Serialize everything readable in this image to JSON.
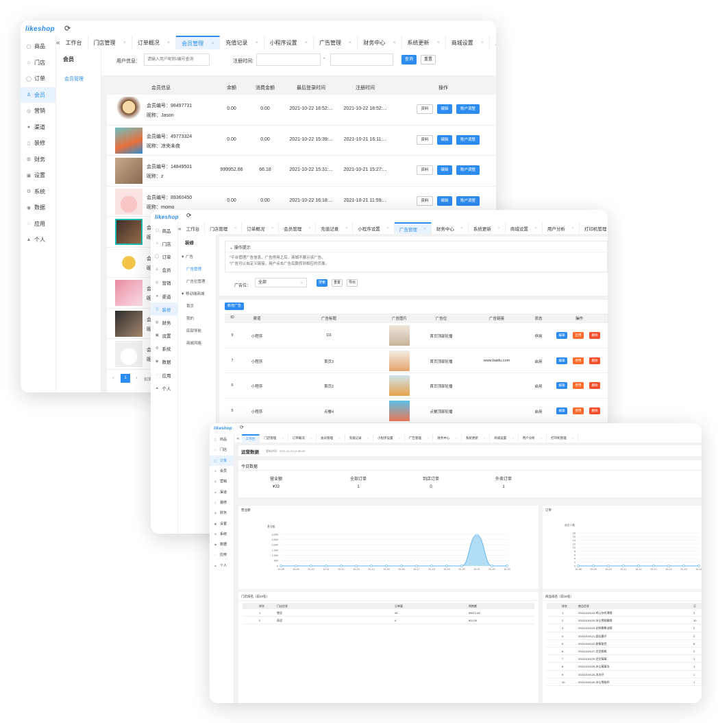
{
  "sidebar": {
    "logo": "likeshop",
    "items": [
      {
        "label": "商品",
        "icon": "goods-icon"
      },
      {
        "label": "门店",
        "icon": "store-icon"
      },
      {
        "label": "订单",
        "icon": "order-icon"
      },
      {
        "label": "会员",
        "icon": "user-icon"
      },
      {
        "label": "营销",
        "icon": "marketing-icon"
      },
      {
        "label": "渠道",
        "icon": "channel-icon"
      },
      {
        "label": "装修",
        "icon": "decorate-icon"
      },
      {
        "label": "财务",
        "icon": "finance-icon"
      },
      {
        "label": "设置",
        "icon": "settings-icon"
      },
      {
        "label": "系统",
        "icon": "system-icon"
      },
      {
        "label": "数据",
        "icon": "data-icon"
      },
      {
        "label": "应用",
        "icon": "app-icon"
      },
      {
        "label": "个人",
        "icon": "person-icon"
      }
    ]
  },
  "tabs": [
    "工作台",
    "门店管理",
    "订单概况",
    "会员管理",
    "充值记录",
    "小程序设置",
    "广告管理",
    "财务中心",
    "系统更新",
    "商城设置",
    "用户分析",
    "打印机管理"
  ],
  "win1": {
    "sub_title": "会员",
    "sub_item": "会员管理",
    "filter": {
      "user_label": "用户信息：",
      "user_placeholder": "请输入用户昵称/编号查询",
      "reg_label": "注册时间:",
      "dash": "-",
      "query": "查询",
      "reset": "重置"
    },
    "columns": [
      "会员信息",
      "余额",
      "消费金额",
      "最后登录时间",
      "注册时间",
      "操作"
    ],
    "rows": [
      {
        "id": "会员编号：98497731",
        "nick": "昵称：Jason",
        "balance": "0.00",
        "spent": "0.00",
        "last": "2021-10-22 18:52:...",
        "reg": "2021-10-22 18:52:..."
      },
      {
        "id": "会员编号：49773324",
        "nick": "昵称：凉夹未夜",
        "balance": "0.00",
        "spent": "0.00",
        "last": "2021-10-22 15:39:...",
        "reg": "2021-10-21 16:11:..."
      },
      {
        "id": "会员编号：14849501",
        "nick": "昵称：z",
        "balance": "999952.86",
        "spent": "66.18",
        "last": "2021-10-22 15:31:...",
        "reg": "2021-10-21 15:27:..."
      },
      {
        "id": "会员编号：89360450",
        "nick": "昵称：momo",
        "balance": "0.00",
        "spent": "0.00",
        "last": "2021-10-22 16:18:...",
        "reg": "2021-10-21 11:59:..."
      }
    ],
    "partial": [
      "会",
      "昵",
      "会",
      "昵",
      "会",
      "昵",
      "会",
      "昵",
      "会",
      "昵"
    ],
    "actions": {
      "info": "资料",
      "edit": "编辑",
      "adjust": "账户调整"
    },
    "page": "1",
    "page_tail": "如第"
  },
  "win2": {
    "sub_title": "装修",
    "tree": [
      {
        "label": "▼ 广告",
        "level": 0
      },
      {
        "label": "广告管理",
        "level": 1,
        "active": true
      },
      {
        "label": "广告位管理",
        "level": 1
      },
      {
        "label": "▼ 移动端商城",
        "level": 0
      },
      {
        "label": "首页",
        "level": 1
      },
      {
        "label": "我的",
        "level": 1
      },
      {
        "label": "底部导航",
        "level": 1
      },
      {
        "label": "商城风格",
        "level": 1
      }
    ],
    "tip_title": "操作提示",
    "tips": [
      "*平台管理广告信息，广告停用之后，商城不展示该广告。",
      "*广告可以自定义链接，用户点击广告后跳转到相应的页面。"
    ],
    "filter": {
      "label": "广告位：",
      "value": "全部",
      "query": "搜索",
      "reset": "重置",
      "export": "导出"
    },
    "add": "新增广告",
    "columns": [
      "ID",
      "渠道",
      "广告标题",
      "广告图片",
      "广告位",
      "广告链接",
      "状态",
      "操作"
    ],
    "rows": [
      {
        "id": "9",
        "ch": "小程序",
        "title": "111",
        "pos": "首页顶部轮播",
        "link": "",
        "status": "停用",
        "toggle": "启用"
      },
      {
        "id": "7",
        "ch": "小程序",
        "title": "首页3",
        "pos": "首页顶部轮播",
        "link": "www.baidu.com",
        "status": "启用",
        "toggle": "停用"
      },
      {
        "id": "6",
        "ch": "小程序",
        "title": "首页2",
        "pos": "首页顶部轮播",
        "link": "",
        "status": "启用",
        "toggle": "停用"
      },
      {
        "id": "5",
        "ch": "小程序",
        "title": "点餐4",
        "pos": "点餐顶部轮播",
        "link": "",
        "status": "启用",
        "toggle": "停用"
      }
    ],
    "actions": {
      "edit": "编辑",
      "delete": "删除"
    }
  },
  "win3": {
    "title": "运营数据",
    "updated": "更新时间：2021-10-23 11:36:48",
    "today": "今日数据",
    "stats": [
      {
        "label": "营业额",
        "value": "¥33"
      },
      {
        "label": "全部订单",
        "value": "1"
      },
      {
        "label": "到店订单",
        "value": "0"
      },
      {
        "label": "外卖订单",
        "value": "1"
      }
    ],
    "chart1_title": "营业额",
    "chart2_title": "订单",
    "store_title": "门店排名（前10名）",
    "store_cols": [
      "排名",
      "门店信息",
      "订单量",
      "销售额"
    ],
    "store_rows": [
      [
        "1",
        "雪泥",
        "26",
        "¥3071.48"
      ],
      [
        "2",
        "雨泥",
        "4",
        "¥11.00"
      ]
    ],
    "goods_title": "商品排名（前10名）",
    "goods_cols": [
      "排名",
      "商品信息",
      "订"
    ],
    "goods_rows": [
      [
        "1",
        "20211019123-鸡公杂的渴哦",
        "3"
      ],
      [
        "2",
        "20211019120-冰山雪糕霸哦",
        "10"
      ],
      [
        "3",
        "20211019123-花样椰椰油哦",
        "2"
      ],
      [
        "4",
        "20211019121-面佳番仔",
        "2"
      ],
      [
        "5",
        "20211019122-甜蜜甜芭",
        "6"
      ],
      [
        "6",
        "20211019127-芝芝桃桃",
        "2"
      ],
      [
        "7",
        "20211019129-芝芝莓莓",
        "1"
      ],
      [
        "8",
        "20211019128-冰山莓莓冻",
        "1"
      ],
      [
        "9",
        "20211019124-冻冻仔",
        "1"
      ],
      [
        "10",
        "20211019120-冰山雪糕杯",
        "1"
      ]
    ]
  },
  "chart_data": [
    {
      "type": "area",
      "title": "营业额",
      "ylabel": "营业额",
      "categories": [
        "10-08",
        "10-09",
        "10-10",
        "10-11",
        "10-12",
        "10-13",
        "10-14",
        "10-15",
        "10-16",
        "10-17",
        "10-18",
        "10-19",
        "10-20",
        "10-21",
        "10-22",
        "10-23"
      ],
      "values": [
        0,
        0,
        0,
        0,
        0,
        0,
        0,
        0,
        0,
        0,
        0,
        0,
        0,
        2950,
        0,
        0
      ],
      "yticks": [
        "3,000",
        "2,500",
        "2,000",
        "1,500",
        "1,000",
        "500",
        "0"
      ],
      "ylim": [
        0,
        3000
      ]
    },
    {
      "type": "line",
      "title": "订单",
      "ylabel": "成交人数",
      "categories": [
        "10-08",
        "10-09",
        "10-10",
        "10-11",
        "10-12",
        "10-13",
        "10-14",
        "10-15",
        "10-16"
      ],
      "values": [
        0,
        0,
        0,
        0,
        0,
        0,
        0,
        0,
        0
      ],
      "yticks": [
        "18",
        "16",
        "14",
        "12",
        "10",
        "8",
        "6",
        "4",
        "2",
        "0"
      ],
      "ylim": [
        0,
        18
      ]
    }
  ],
  "colors": {
    "accent": "#2d8cf0",
    "danger": "#f5502c",
    "line": "#5bb4f0",
    "area": "#9dd4f5"
  }
}
